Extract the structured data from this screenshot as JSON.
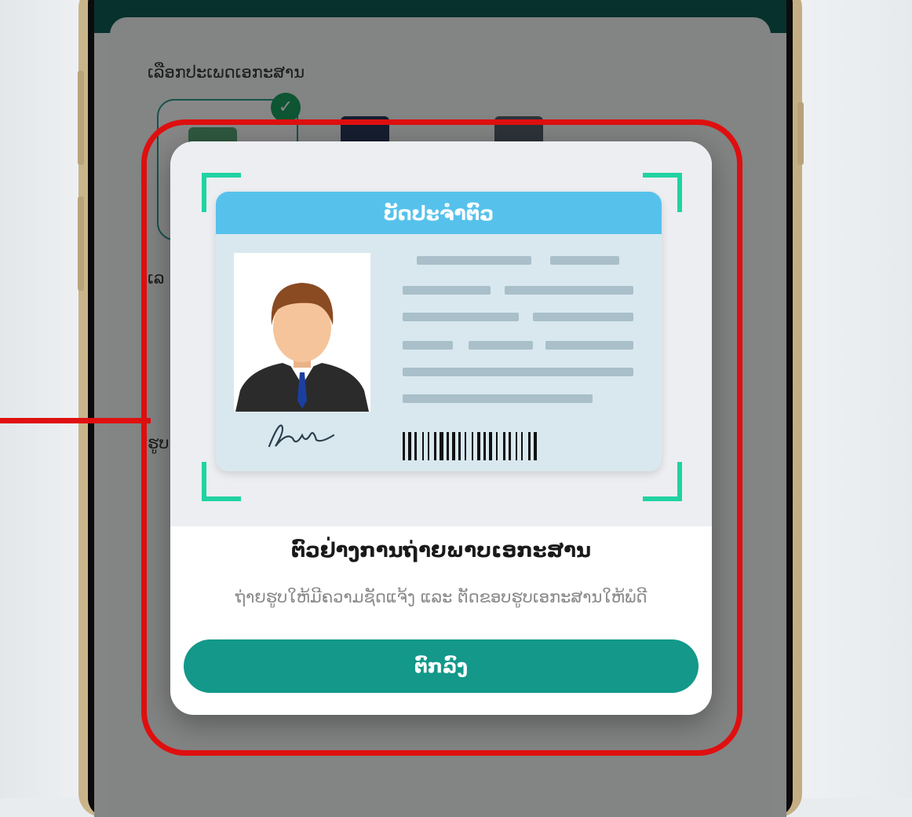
{
  "page": {
    "doc_type_label": "ເລືອກປະເພດເອກະສານ",
    "partial_label_1": "ເລ",
    "partial_label_2": "ຮູບ"
  },
  "dialog": {
    "card_title": "ບັດປະຈຳຕົວ",
    "title": "ຕົວຢ່າງການຖ່າຍພາບເອກະສານ",
    "subtitle": "ຖ່າຍຮູບໃຫ້ມີຄວາມຊັດແຈ້ງ ແລະ ຕັດຂອບຮູບເອກະສານໃຫ້ພໍດີ",
    "ok_label": "ຕົກລົງ"
  },
  "icons": {
    "selected_badge": "check-circle-icon",
    "frame_corners": "scan-frame-corner-icon",
    "card_photo": "person-avatar-icon",
    "barcode": "barcode-icon"
  },
  "colors": {
    "highlight": "#e01010",
    "primary_button": "#13988a",
    "scan_corner": "#1fd3a2",
    "card_header": "#56c2ec",
    "app_header": "#0e5e55"
  }
}
